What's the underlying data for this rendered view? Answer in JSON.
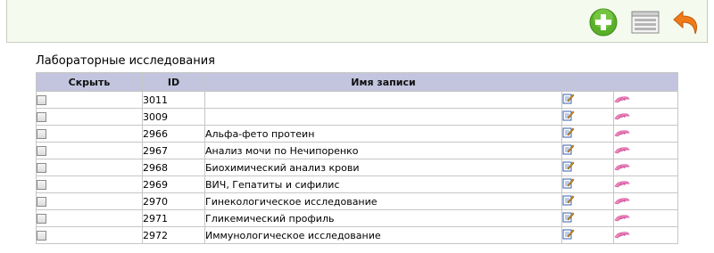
{
  "toolbar": {
    "icons": [
      "add-icon",
      "list-view-icon",
      "back-arrow-icon"
    ],
    "colors": {
      "background": "#f4fbee",
      "add_green": "#5bb02a",
      "back_orange": "#f07a1a"
    }
  },
  "section": {
    "title": "Лабораторные исследования"
  },
  "table": {
    "headers": {
      "hide": "Скрыть",
      "id": "ID",
      "name": "Имя записи",
      "edit": "",
      "delete": ""
    },
    "header_bg": "#c2c5dd",
    "rows": [
      {
        "id": "3011",
        "name": ""
      },
      {
        "id": "3009",
        "name": ""
      },
      {
        "id": "2966",
        "name": "Альфа-фето протеин"
      },
      {
        "id": "2967",
        "name": "Анализ мочи по Нечипоренко"
      },
      {
        "id": "2968",
        "name": "Биохимический анализ крови"
      },
      {
        "id": "2969",
        "name": "ВИЧ, Гепатиты и сифилис"
      },
      {
        "id": "2970",
        "name": "Гинекологическое исследование"
      },
      {
        "id": "2971",
        "name": "Гликемический профиль"
      },
      {
        "id": "2972",
        "name": "Иммунологическое исследование"
      }
    ],
    "row_icons": {
      "edit": "edit-icon",
      "delete": "eraser-icon"
    }
  }
}
